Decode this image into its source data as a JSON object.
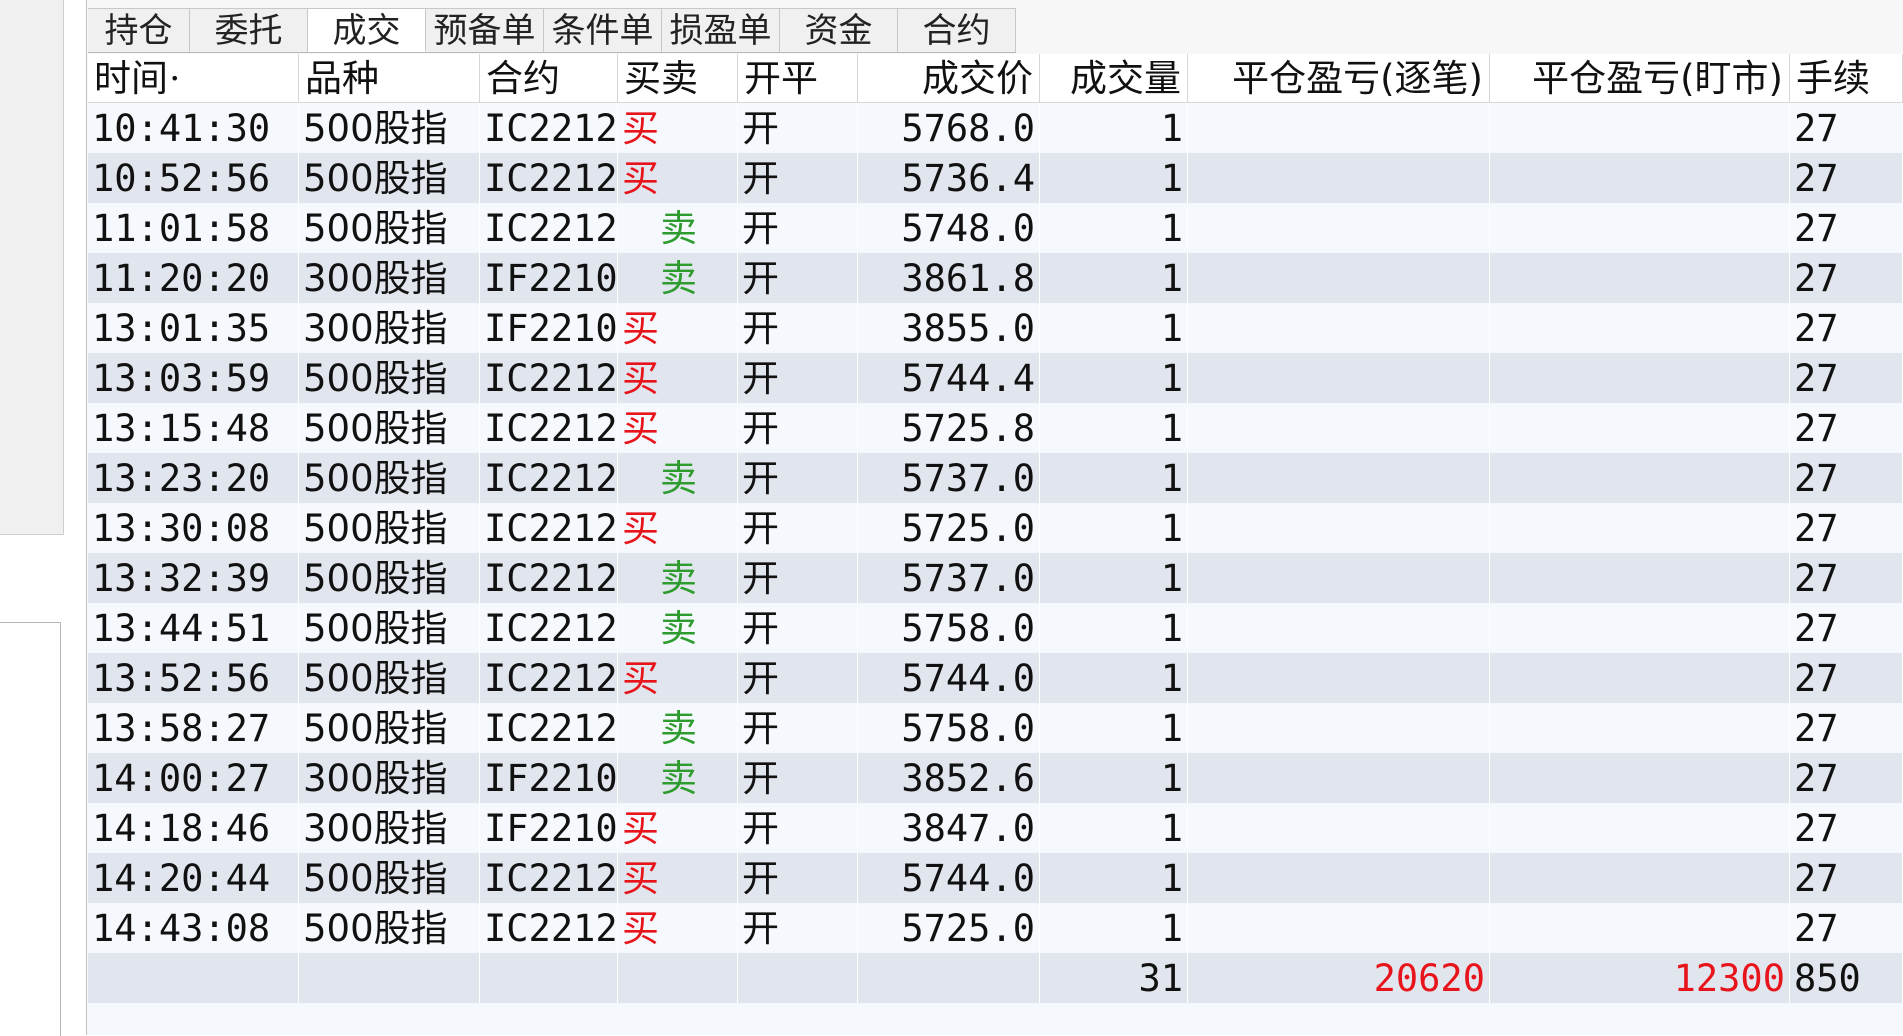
{
  "tabs": [
    {
      "label": "持仓",
      "active": false
    },
    {
      "label": "委托",
      "active": false
    },
    {
      "label": "成交",
      "active": true
    },
    {
      "label": "预备单",
      "active": false
    },
    {
      "label": "条件单",
      "active": false
    },
    {
      "label": "损盈单",
      "active": false
    },
    {
      "label": "资金",
      "active": false
    },
    {
      "label": "合约",
      "active": false
    }
  ],
  "columns": [
    "时间",
    "品种",
    "合约",
    "买卖",
    "开平",
    "成交价",
    "成交量",
    "平仓盈亏(逐笔)",
    "平仓盈亏(盯市)",
    "手续"
  ],
  "rows": [
    {
      "time": "10:41:30",
      "product": "500股指",
      "contract": "IC2212",
      "side": "买",
      "open_close": "开",
      "price": "5768.0",
      "qty": "1",
      "fee": "27"
    },
    {
      "time": "10:52:56",
      "product": "500股指",
      "contract": "IC2212",
      "side": "买",
      "open_close": "开",
      "price": "5736.4",
      "qty": "1",
      "fee": "27"
    },
    {
      "time": "11:01:58",
      "product": "500股指",
      "contract": "IC2212",
      "side": "卖",
      "open_close": "开",
      "price": "5748.0",
      "qty": "1",
      "fee": "27"
    },
    {
      "time": "11:20:20",
      "product": "300股指",
      "contract": "IF2210",
      "side": "卖",
      "open_close": "开",
      "price": "3861.8",
      "qty": "1",
      "fee": "27"
    },
    {
      "time": "13:01:35",
      "product": "300股指",
      "contract": "IF2210",
      "side": "买",
      "open_close": "开",
      "price": "3855.0",
      "qty": "1",
      "fee": "27"
    },
    {
      "time": "13:03:59",
      "product": "500股指",
      "contract": "IC2212",
      "side": "买",
      "open_close": "开",
      "price": "5744.4",
      "qty": "1",
      "fee": "27"
    },
    {
      "time": "13:15:48",
      "product": "500股指",
      "contract": "IC2212",
      "side": "买",
      "open_close": "开",
      "price": "5725.8",
      "qty": "1",
      "fee": "27"
    },
    {
      "time": "13:23:20",
      "product": "500股指",
      "contract": "IC2212",
      "side": "卖",
      "open_close": "开",
      "price": "5737.0",
      "qty": "1",
      "fee": "27"
    },
    {
      "time": "13:30:08",
      "product": "500股指",
      "contract": "IC2212",
      "side": "买",
      "open_close": "开",
      "price": "5725.0",
      "qty": "1",
      "fee": "27"
    },
    {
      "time": "13:32:39",
      "product": "500股指",
      "contract": "IC2212",
      "side": "卖",
      "open_close": "开",
      "price": "5737.0",
      "qty": "1",
      "fee": "27"
    },
    {
      "time": "13:44:51",
      "product": "500股指",
      "contract": "IC2212",
      "side": "卖",
      "open_close": "开",
      "price": "5758.0",
      "qty": "1",
      "fee": "27"
    },
    {
      "time": "13:52:56",
      "product": "500股指",
      "contract": "IC2212",
      "side": "买",
      "open_close": "开",
      "price": "5744.0",
      "qty": "1",
      "fee": "27"
    },
    {
      "time": "13:58:27",
      "product": "500股指",
      "contract": "IC2212",
      "side": "卖",
      "open_close": "开",
      "price": "5758.0",
      "qty": "1",
      "fee": "27"
    },
    {
      "time": "14:00:27",
      "product": "300股指",
      "contract": "IF2210",
      "side": "卖",
      "open_close": "开",
      "price": "3852.6",
      "qty": "1",
      "fee": "27"
    },
    {
      "time": "14:18:46",
      "product": "300股指",
      "contract": "IF2210",
      "side": "买",
      "open_close": "开",
      "price": "3847.0",
      "qty": "1",
      "fee": "27"
    },
    {
      "time": "14:20:44",
      "product": "500股指",
      "contract": "IC2212",
      "side": "买",
      "open_close": "开",
      "price": "5744.0",
      "qty": "1",
      "fee": "27"
    },
    {
      "time": "14:43:08",
      "product": "500股指",
      "contract": "IC2212",
      "side": "买",
      "open_close": "开",
      "price": "5725.0",
      "qty": "1",
      "fee": "27"
    }
  ],
  "totals": {
    "qty": "31",
    "pnl_trade": "20620",
    "pnl_mark": "12300",
    "fee": "850"
  },
  "colors": {
    "buy": "#e8141c",
    "sell": "#2e9b2e",
    "row_even": "#e1e6ee",
    "row_odd": "#f5f8fc"
  }
}
